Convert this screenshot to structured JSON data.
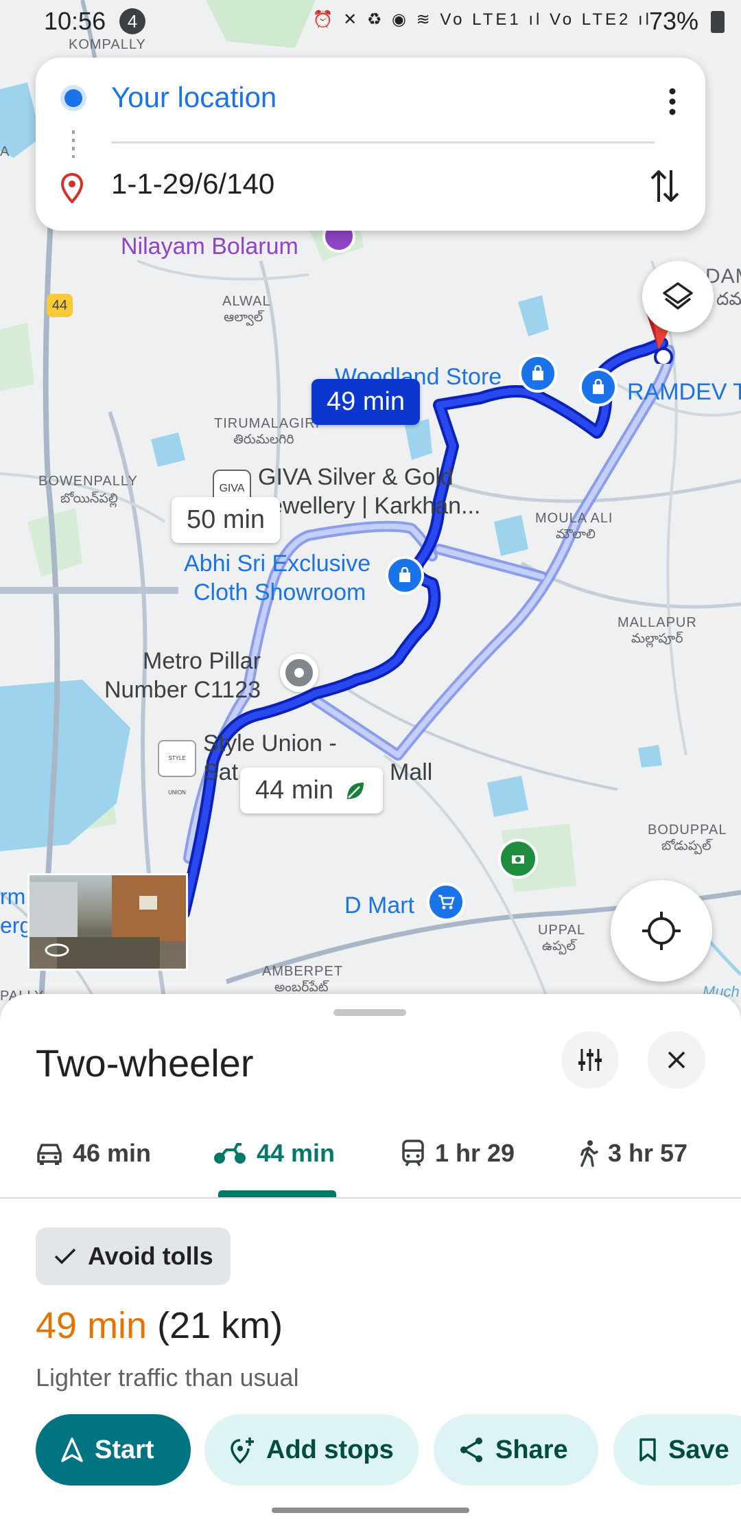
{
  "status_bar": {
    "time": "10:56",
    "notification_count": "4",
    "signal_icons": "⏰ ✕ ♻ ◉ ≋ Vo LTE1 ıl Vo LTE2 ıl",
    "battery": "73%"
  },
  "directions": {
    "origin": "Your location",
    "destination": "1-1-29/6/140"
  },
  "map": {
    "labels": {
      "kompally": "KOMPALLY",
      "nilayam": "Nilayam Bolarum",
      "highway": "44",
      "alwal": "ALWAL",
      "alwal_te": "ఆల్వాల్",
      "tirumalagiri": "TIRUMALAGIRI",
      "tirumalagiri_te": "తిరుమలగిరి",
      "bowenpally": "BOWENPALLY",
      "bowenpally_te": "బోయిన్‌పల్లి",
      "woodland": "Woodland Store",
      "ramdev": "RAMDEV T",
      "dam": "DAM",
      "dam_te": "దమ",
      "giva_line1": "GIVA Silver & Gold",
      "giva_line2": "Jewellery | Karkhan...",
      "giva_logo": "GIVA",
      "moula_ali": "MOULA ALI",
      "moula_ali_te": "మౌలాలి",
      "abhi_line1": "Abhi Sri Exclusive",
      "abhi_line2": "Cloth Showroom",
      "mallapur": "MALLAPUR",
      "mallapur_te": "మల్లాపూర్",
      "metro_line1": "Metro Pillar",
      "metro_line2": "Number C1123",
      "style_line1": "Style Union -",
      "style_line2": "Sat",
      "mall": "Mall",
      "style_logo": "STYLE UNION",
      "boduppal": "BODUPPAL",
      "boduppal_te": "బోడుప్పల్",
      "dmart": "D Mart",
      "uppal": "UPPAL",
      "uppal_te": "ఉప్పల్",
      "amberpet": "AMBERPET",
      "amberpet_te": "అంబర్‌పేట్",
      "left_edge1": "A",
      "left_edge2": "rm",
      "left_edge3": "erg",
      "left_edge4": "PALLY",
      "much": "Much"
    },
    "route_bubbles": {
      "selected": "49 min",
      "alt1": "50 min",
      "alt2": "44 min"
    }
  },
  "sheet": {
    "title": "Two-wheeler",
    "tabs": [
      {
        "mode": "car",
        "label": "46 min"
      },
      {
        "mode": "two-wheeler",
        "label": "44 min"
      },
      {
        "mode": "transit",
        "label": "1 hr 29"
      },
      {
        "mode": "walk",
        "label": "3 hr 57"
      }
    ],
    "chip": "Avoid tolls",
    "duration": "49 min",
    "distance": "(21 km)",
    "traffic": "Lighter traffic than usual",
    "actions": {
      "start": "Start",
      "add_stops": "Add stops",
      "share": "Share",
      "save": "Save"
    }
  },
  "colors": {
    "route_selected": "#1a2ee8",
    "route_alt": "#9db3f2",
    "accent_teal": "#007480",
    "duration_orange": "#e37400"
  }
}
